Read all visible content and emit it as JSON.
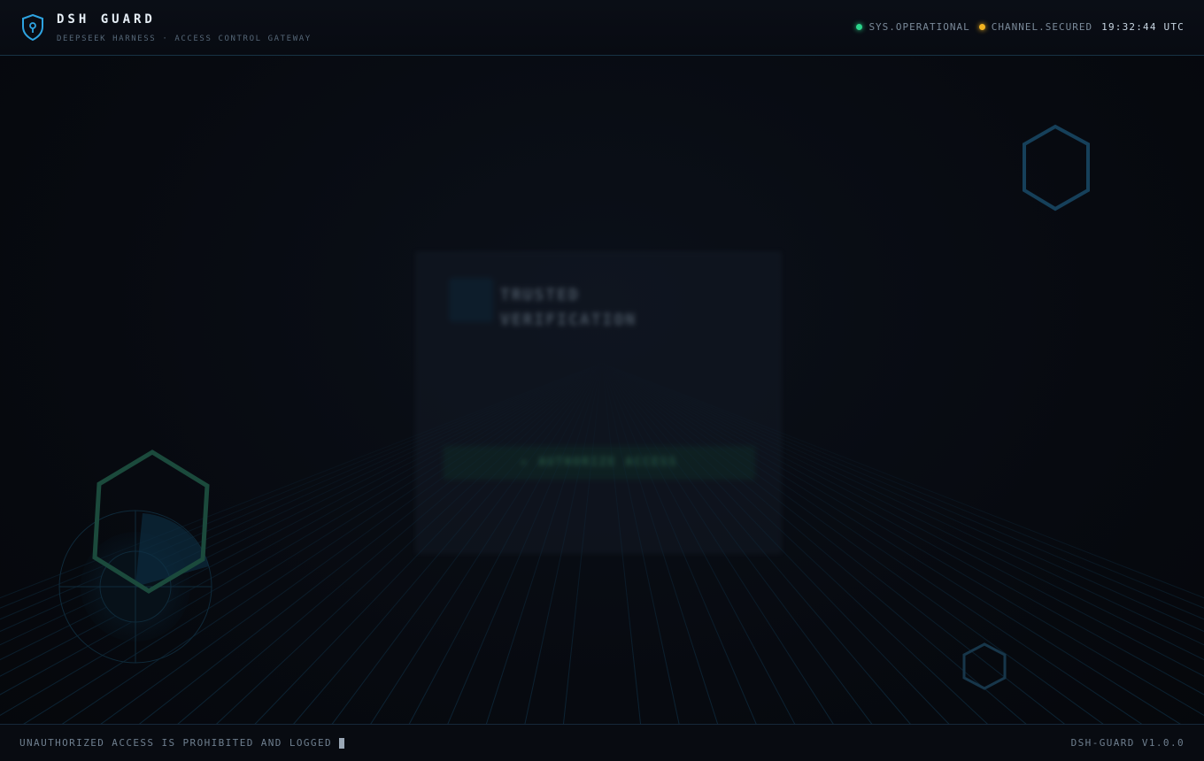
{
  "header": {
    "title": "DSH GUARD",
    "subtitle": "DEEPSEEK HARNESS · ACCESS CONTROL GATEWAY",
    "status_items": [
      {
        "label": "SYS.OPERATIONAL",
        "color": "#2bd48a"
      },
      {
        "label": "CHANNEL.SECURED",
        "color": "#f2b320"
      }
    ],
    "clock": "19:32:44 UTC"
  },
  "card": {
    "title_line1": "TRUSTED",
    "title_line2": "VERIFICATION",
    "button_label": "▸ AUTHORIZE ACCESS"
  },
  "footer": {
    "warning": "UNAUTHORIZED ACCESS IS PROHIBITED AND LOGGED",
    "version": "DSH-GUARD V1.0.0"
  },
  "colors": {
    "accent": "#2ea3e0",
    "background": "#070a10",
    "grid": "#123048",
    "hex_blue": "#16405a",
    "hex_green": "#1b4a3c"
  },
  "icons": {
    "brand": "shield-lock-icon"
  }
}
